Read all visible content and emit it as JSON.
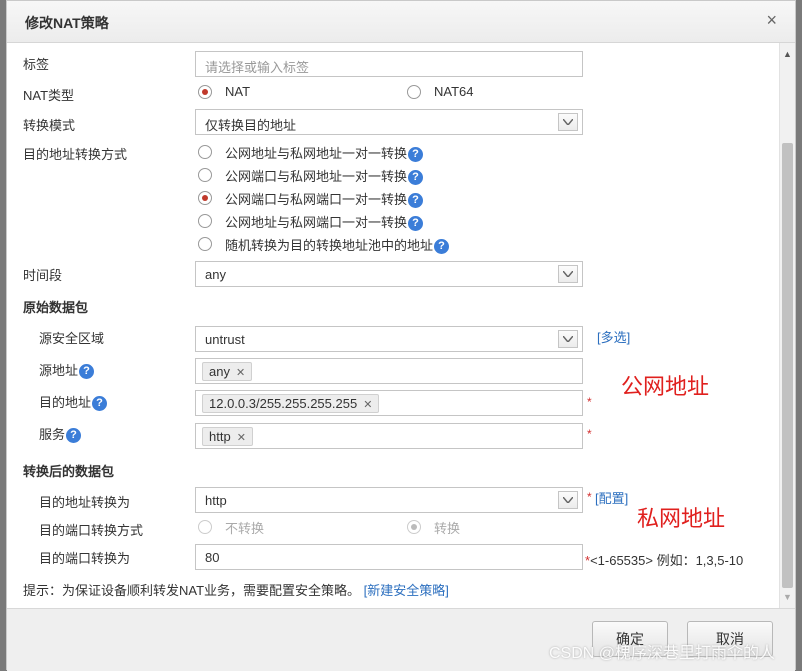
{
  "dialog": {
    "title": "修改NAT策略",
    "close": "×"
  },
  "form": {
    "tag": {
      "label": "标签",
      "placeholder": "请选择或输入标签"
    },
    "nat_type": {
      "label": "NAT类型",
      "options": [
        "NAT",
        "NAT64"
      ],
      "selected": "NAT"
    },
    "convert_mode": {
      "label": "转换模式",
      "value": "仅转换目的地址"
    },
    "dst_method": {
      "label": "目的地址转换方式",
      "options": [
        "公网地址与私网地址一对一转换",
        "公网端口与私网地址一对一转换",
        "公网端口与私网端口一对一转换",
        "公网地址与私网端口一对一转换",
        "随机转换为目的转换地址池中的地址"
      ],
      "selected_index": 2
    },
    "time_range": {
      "label": "时间段",
      "value": "any"
    },
    "original": {
      "section": "原始数据包",
      "src_zone": {
        "label": "源安全区域",
        "value": "untrust",
        "link": "[多选]"
      },
      "src_addr": {
        "label": "源地址",
        "tag": "any"
      },
      "dst_addr": {
        "label": "目的地址",
        "tag": "12.0.0.3/255.255.255.255"
      },
      "service": {
        "label": "服务",
        "tag": "http"
      }
    },
    "translated": {
      "section": "转换后的数据包",
      "dst_addr": {
        "label": "目的地址转换为",
        "value": "http",
        "link": "[配置]"
      },
      "dst_port_method": {
        "label": "目的端口转换方式",
        "options": [
          "不转换",
          "转换"
        ],
        "selected": "转换"
      },
      "dst_port": {
        "label": "目的端口转换为",
        "value": "80",
        "hint": "<1-65535> 例如：1,3,5-10"
      }
    },
    "tip": {
      "text": "提示：为保证设备顺利转发NAT业务，需要配置安全策略。",
      "link": "[新建安全策略]"
    },
    "required_mark": "*",
    "help_glyph": "?",
    "tag_remove": "✕"
  },
  "annotations": {
    "public": "公网地址",
    "private": "私网地址"
  },
  "footer": {
    "ok": "确定",
    "cancel": "取消",
    "watermark": "CSDN @槐序深巷里打雨伞的人"
  }
}
